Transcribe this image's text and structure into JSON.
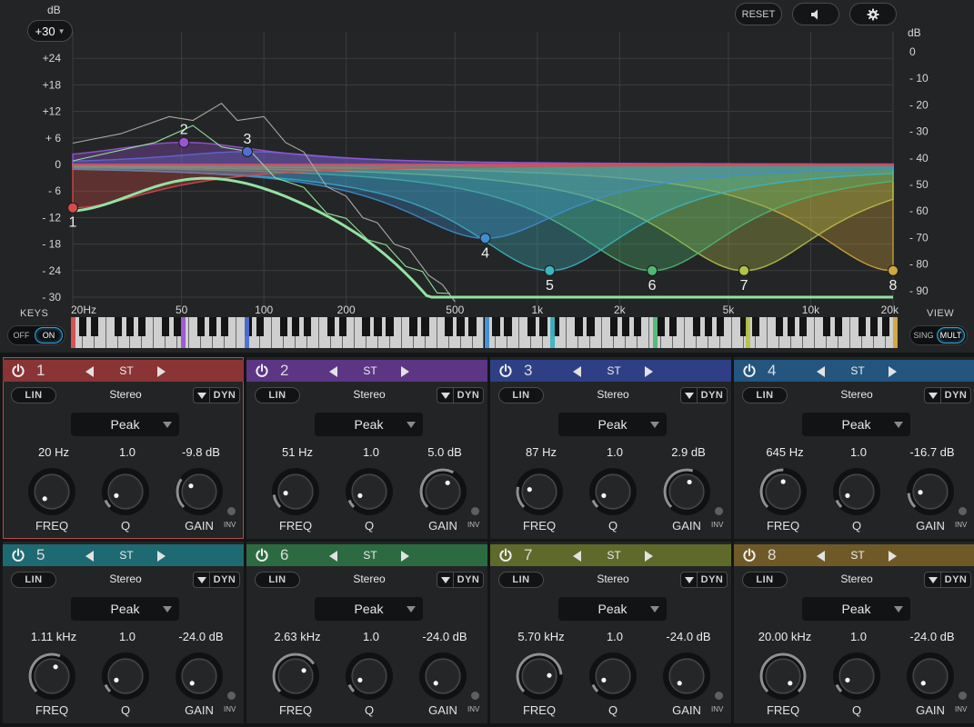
{
  "header": {
    "db_label": "dB",
    "range_value": "+30",
    "reset_label": "RESET",
    "right_db_label": "dB"
  },
  "graph": {
    "left_db_labels": [
      "+24",
      "+18",
      "+12",
      "+ 6",
      "0",
      "- 6",
      "- 12",
      "- 18",
      "- 24",
      "- 30"
    ],
    "left_db_values": [
      24,
      18,
      12,
      6,
      0,
      -6,
      -12,
      -18,
      -24,
      -30
    ],
    "right_db_labels": [
      "0",
      "- 10",
      "- 20",
      "- 30",
      "- 40",
      "- 50",
      "- 60",
      "- 70",
      "- 80",
      "- 90"
    ],
    "freq_labels": [
      "20Hz",
      "50",
      "100",
      "200",
      "500",
      "1k",
      "2k",
      "5k",
      "10k",
      "20k"
    ],
    "freq_values": [
      20,
      50,
      100,
      200,
      500,
      1000,
      2000,
      5000,
      10000,
      20000
    ],
    "gridline_freqs": [
      20,
      50,
      100,
      200,
      500,
      1000,
      2000,
      5000,
      10000,
      20000
    ]
  },
  "keys": {
    "label": "KEYS",
    "off": "OFF",
    "on": "ON"
  },
  "view": {
    "label": "VIEW",
    "sing": "SING",
    "mult": "MULT"
  },
  "bands": [
    {
      "num": "1",
      "color": "#d94a4c",
      "head": "#8a3436",
      "mode": "ST",
      "lin": "LIN",
      "channel": "Stereo",
      "dyn": "DYN",
      "type": "Peak",
      "freq": "20 Hz",
      "q": "1.0",
      "gain": "-9.8 dB",
      "freq_hz": 20,
      "q_value": 1.0,
      "gain_db": -9.8,
      "freq_label": "FREQ",
      "q_label": "Q",
      "gain_label": "GAIN",
      "inv": "INV"
    },
    {
      "num": "2",
      "color": "#9a55d6",
      "head": "#5c3585",
      "mode": "ST",
      "lin": "LIN",
      "channel": "Stereo",
      "dyn": "DYN",
      "type": "Peak",
      "freq": "51 Hz",
      "q": "1.0",
      "gain": "5.0 dB",
      "freq_hz": 51,
      "q_value": 1.0,
      "gain_db": 5.0,
      "freq_label": "FREQ",
      "q_label": "Q",
      "gain_label": "GAIN",
      "inv": "INV"
    },
    {
      "num": "3",
      "color": "#4f6fd4",
      "head": "#2e3f86",
      "mode": "ST",
      "lin": "LIN",
      "channel": "Stereo",
      "dyn": "DYN",
      "type": "Peak",
      "freq": "87 Hz",
      "q": "1.0",
      "gain": "2.9 dB",
      "freq_hz": 87,
      "q_value": 1.0,
      "gain_db": 2.9,
      "freq_label": "FREQ",
      "q_label": "Q",
      "gain_label": "GAIN",
      "inv": "INV"
    },
    {
      "num": "4",
      "color": "#3f8ed2",
      "head": "#23557f",
      "mode": "ST",
      "lin": "LIN",
      "channel": "Stereo",
      "dyn": "DYN",
      "type": "Peak",
      "freq": "645 Hz",
      "q": "1.0",
      "gain": "-16.7 dB",
      "freq_hz": 645,
      "q_value": 1.0,
      "gain_db": -16.7,
      "freq_label": "FREQ",
      "q_label": "Q",
      "gain_label": "GAIN",
      "inv": "INV"
    },
    {
      "num": "5",
      "color": "#3bb5c2",
      "head": "#1e6a72",
      "mode": "ST",
      "lin": "LIN",
      "channel": "Stereo",
      "dyn": "DYN",
      "type": "Peak",
      "freq": "1.11 kHz",
      "q": "1.0",
      "gain": "-24.0 dB",
      "freq_hz": 1110,
      "q_value": 1.0,
      "gain_db": -24.0,
      "freq_label": "FREQ",
      "q_label": "Q",
      "gain_label": "GAIN",
      "inv": "INV"
    },
    {
      "num": "6",
      "color": "#4fb874",
      "head": "#2c6b42",
      "mode": "ST",
      "lin": "LIN",
      "channel": "Stereo",
      "dyn": "DYN",
      "type": "Peak",
      "freq": "2.63 kHz",
      "q": "1.0",
      "gain": "-24.0 dB",
      "freq_hz": 2630,
      "q_value": 1.0,
      "gain_db": -24.0,
      "freq_label": "FREQ",
      "q_label": "Q",
      "gain_label": "GAIN",
      "inv": "INV"
    },
    {
      "num": "7",
      "color": "#b5c24a",
      "head": "#5f6a2a",
      "mode": "ST",
      "lin": "LIN",
      "channel": "Stereo",
      "dyn": "DYN",
      "type": "Peak",
      "freq": "5.70 kHz",
      "q": "1.0",
      "gain": "-24.0 dB",
      "freq_hz": 5700,
      "q_value": 1.0,
      "gain_db": -24.0,
      "freq_label": "FREQ",
      "q_label": "Q",
      "gain_label": "GAIN",
      "inv": "INV"
    },
    {
      "num": "8",
      "color": "#d2a63c",
      "head": "#6f5a27",
      "mode": "ST",
      "lin": "LIN",
      "channel": "Stereo",
      "dyn": "DYN",
      "type": "Peak",
      "freq": "20.00 kHz",
      "q": "1.0",
      "gain": "-24.0 dB",
      "freq_hz": 20000,
      "q_value": 1.0,
      "gain_db": -24.0,
      "freq_label": "FREQ",
      "q_label": "Q",
      "gain_label": "GAIN",
      "inv": "INV"
    }
  ],
  "selected_band": "1",
  "icons": {
    "power": "power-icon",
    "speaker": "speaker-icon",
    "settings": "gear-icon"
  }
}
